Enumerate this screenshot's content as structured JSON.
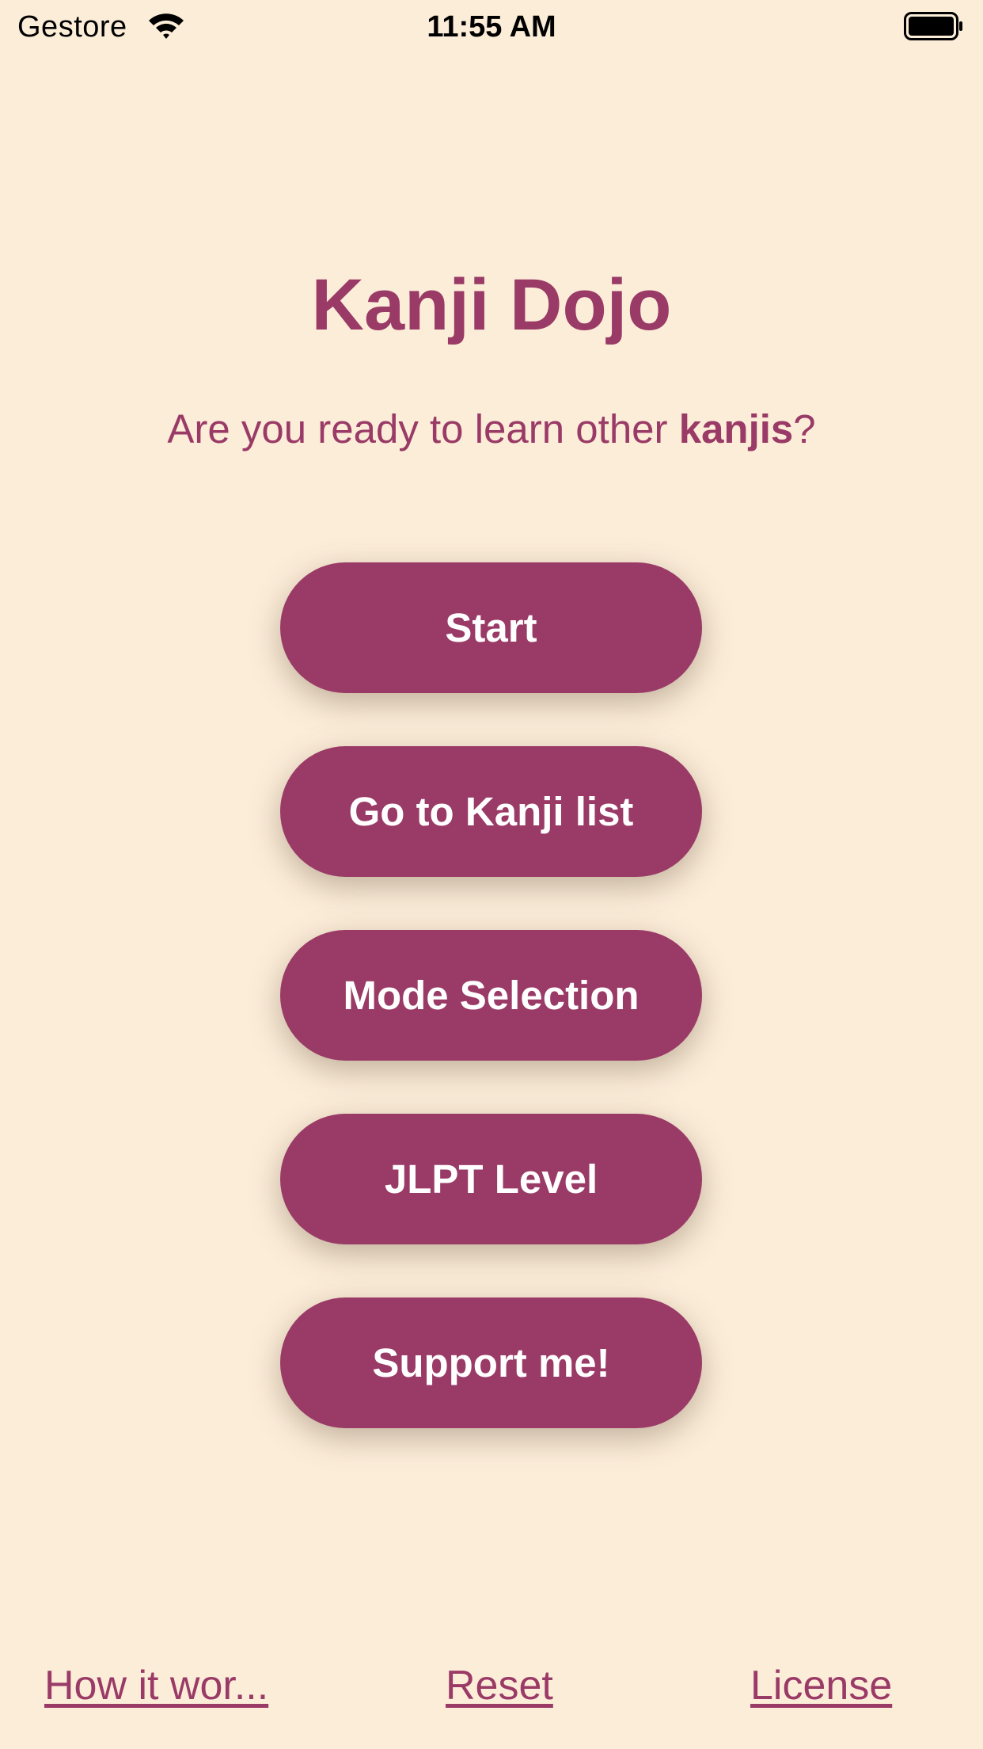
{
  "status_bar": {
    "carrier": "Gestore",
    "time": "11:55 AM",
    "icons": [
      "wifi-icon",
      "battery-icon"
    ]
  },
  "app": {
    "title": "Kanji Dojo",
    "subtitle_prefix": "Are you ready to learn other ",
    "subtitle_bold": "kanjis",
    "subtitle_suffix": "?"
  },
  "menu": {
    "start_label": "Start",
    "kanji_list_label": "Go to Kanji list",
    "mode_selection_label": "Mode Selection",
    "jlpt_level_label": "JLPT Level",
    "support_label": "Support me!"
  },
  "footer": {
    "how_it_works_label": "How it wor...",
    "reset_label": "Reset",
    "license_label": "License"
  },
  "colors": {
    "background": "#FCEDD9",
    "accent": "#9A3A66",
    "button_text": "#FFFFFF"
  }
}
